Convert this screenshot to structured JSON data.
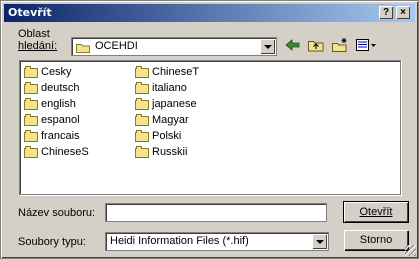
{
  "window": {
    "title": "Otevřít",
    "help_label": "?",
    "close_label": "×"
  },
  "lookin": {
    "label_line1": "Oblast",
    "label_line2": "hledání:",
    "value": "OCEHDI"
  },
  "toolbar": {
    "back_icon": "back-arrow-icon",
    "up_icon": "up-folder-icon",
    "new_folder_icon": "new-folder-icon",
    "view_menu_icon": "view-menu-icon"
  },
  "files": {
    "column1": [
      "Cesky",
      "deutsch",
      "english",
      "espanol",
      "francais",
      "ChineseS"
    ],
    "column2": [
      "ChineseT",
      "italiano",
      "japanese",
      "Magyar",
      "Polski",
      "Russkii"
    ]
  },
  "filename": {
    "label": "Název souboru:",
    "value": ""
  },
  "filetype": {
    "label": "Soubory typu:",
    "value": "Heidi Information Files (*.hif)"
  },
  "buttons": {
    "open": "Otevřít",
    "cancel": "Storno"
  },
  "colors": {
    "title_gradient_start": "#0a246a",
    "title_gradient_end": "#a6caf0",
    "face": "#d4d0c8",
    "folder": "#f5e28f"
  }
}
